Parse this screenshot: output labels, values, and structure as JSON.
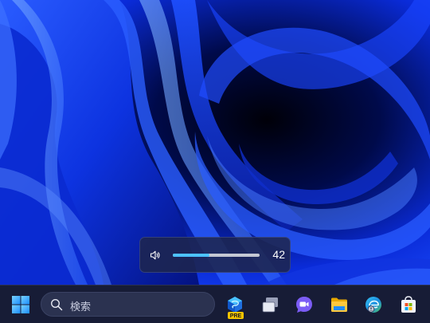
{
  "desktop": {
    "wallpaper": "windows-11-bloom-blue"
  },
  "volume_flyout": {
    "icon": "speaker-icon",
    "level": 42,
    "level_label": "42"
  },
  "taskbar": {
    "search": {
      "placeholder": "検索",
      "icon": "search-icon"
    },
    "apps": [
      {
        "name": "start",
        "icon": "windows-logo-icon"
      },
      {
        "name": "edge-preview",
        "icon": "edge-pre-icon",
        "badge": "PRE"
      },
      {
        "name": "task-view",
        "icon": "task-view-icon"
      },
      {
        "name": "teams-meet",
        "icon": "video-chat-icon"
      },
      {
        "name": "file-explorer",
        "icon": "folder-icon"
      },
      {
        "name": "edge-profile",
        "icon": "edge-icon"
      },
      {
        "name": "microsoft-store",
        "icon": "store-icon"
      }
    ]
  },
  "colors": {
    "accent": "#4cc2ff",
    "taskbar_bg": "#171c36",
    "flyout_bg": "#1e264e"
  }
}
